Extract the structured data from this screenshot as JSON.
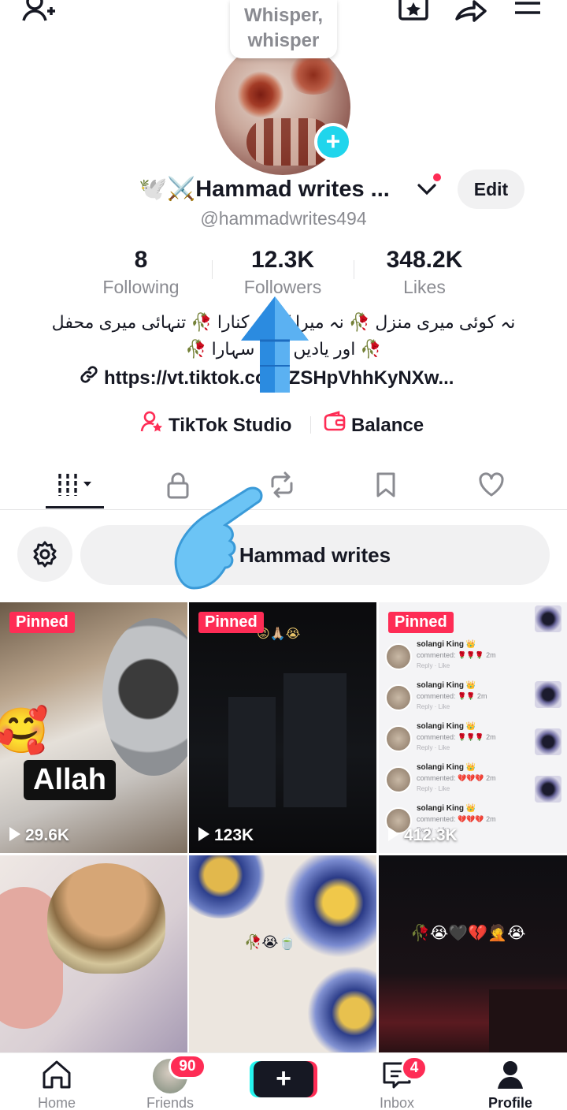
{
  "top_bar": {
    "icons": [
      "add-friend-icon",
      "favorites-icon",
      "share-icon",
      "menu-icon"
    ]
  },
  "profile": {
    "note": [
      "Whisper,",
      "whisper"
    ],
    "display_name": "🕊️⚔️Hammad writes ...",
    "username": "@hammadwrites494",
    "edit_label": "Edit",
    "stats": [
      {
        "value": "8",
        "label": "Following"
      },
      {
        "value": "12.3K",
        "label": "Followers"
      },
      {
        "value": "348.2K",
        "label": "Likes"
      }
    ],
    "bio_line1": "نہ کوئی میری منزل 🥀 نہ میرا کوئی کنارا 🥀 تنہائی میری محفل",
    "bio_line2": "🥀 اور یادیں میرا سہارا 🥀",
    "link": "https://vt.tiktok.com/ZSHpVhhKyNXw...",
    "studio_label": "TikTok Studio",
    "balance_label": "Balance"
  },
  "tabs": [
    {
      "name": "videos",
      "icon": "grid-icon",
      "active": true
    },
    {
      "name": "private",
      "icon": "lock-icon",
      "active": false
    },
    {
      "name": "reposts",
      "icon": "repost-icon",
      "active": false
    },
    {
      "name": "saved",
      "icon": "bookmark-icon",
      "active": false
    },
    {
      "name": "liked",
      "icon": "heart-icon",
      "active": false
    }
  ],
  "filter": {
    "chip_label": "Hammad writes"
  },
  "videos": [
    {
      "pinned": "Pinned",
      "views": "29.6K",
      "caption": "Allah"
    },
    {
      "pinned": "Pinned",
      "views": "123K"
    },
    {
      "pinned": "Pinned",
      "views": "412.3K"
    },
    {},
    {
      "caption": "🥀😭🍵"
    },
    {
      "caption": "🥀😭🖤💔🤦😭"
    }
  ],
  "comment_rows": [
    {
      "name": "solangi King 👑",
      "comment": "commented: 🌹🌹🌹 2m",
      "actions": "Reply · Like"
    },
    {
      "name": "solangi King 👑",
      "comment": "commented: 🌹🌹 2m",
      "actions": "Reply · Like"
    },
    {
      "name": "solangi King 👑",
      "comment": "commented: 🌹🌹🌹 2m",
      "actions": "Reply · Like"
    },
    {
      "name": "solangi King 👑",
      "comment": "commented: 💔💔💔 2m",
      "actions": "Reply · Like"
    },
    {
      "name": "solangi King 👑",
      "comment": "commented: 💔💔💔 2m",
      "actions": "Reply · Like"
    }
  ],
  "bottom_nav": {
    "home": "Home",
    "friends": "Friends",
    "friends_badge": "90",
    "create": "+",
    "inbox": "Inbox",
    "inbox_badge": "4",
    "profile": "Profile"
  },
  "colors": {
    "accent": "#fe2c55",
    "cyan": "#25f4ee",
    "text": "#161823",
    "muted": "#8a8b91"
  }
}
